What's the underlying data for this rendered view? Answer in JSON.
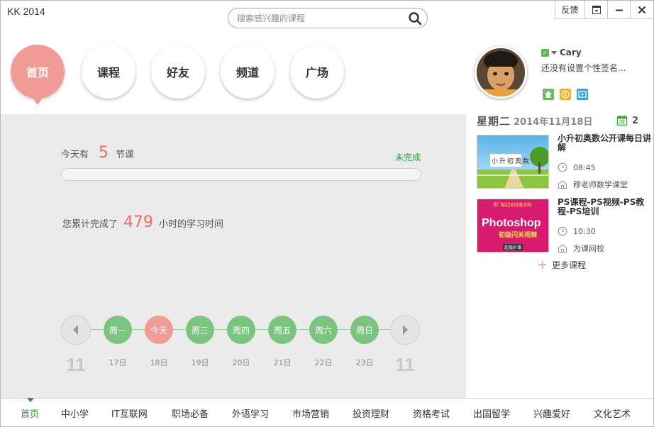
{
  "app": {
    "title": "KK 2014"
  },
  "search": {
    "placeholder": "搜索感兴趣的课程"
  },
  "window_controls": {
    "feedback": "反馈"
  },
  "nav": [
    {
      "label": "首页",
      "active": true
    },
    {
      "label": "课程"
    },
    {
      "label": "好友"
    },
    {
      "label": "频道"
    },
    {
      "label": "广场"
    }
  ],
  "today": {
    "prefix": "今天有",
    "count": "5",
    "suffix": "节课",
    "status": "未完成",
    "progress": 0
  },
  "total": {
    "prefix": "您累计完成了",
    "hours": "479",
    "suffix": "小时的学习时间"
  },
  "week": {
    "month_left": "11",
    "month_right": "11",
    "days": [
      {
        "label": "周一",
        "date": "17日"
      },
      {
        "label": "今天",
        "date": "18日",
        "today": true
      },
      {
        "label": "周三",
        "date": "19日"
      },
      {
        "label": "周四",
        "date": "20日"
      },
      {
        "label": "周五",
        "date": "21日"
      },
      {
        "label": "周六",
        "date": "22日"
      },
      {
        "label": "周日",
        "date": "23日"
      }
    ]
  },
  "user": {
    "name": "Cary",
    "signature": "还没有设置个性签名..."
  },
  "schedule": {
    "weekday": "星期二",
    "date": "2014年11月18日",
    "calendar_count": "2",
    "courses": [
      {
        "title": "小升初奥数公开课每日讲解",
        "time": "08:45",
        "school": "穆老师数学课堂",
        "thumb_text": "小升初奥数"
      },
      {
        "title": "PS课程-PS视频-PS教程-PS培训",
        "time": "10:30",
        "school": "为课网校",
        "thumb_line1": "零门槛超值限量抢购",
        "thumb_line2": "Photoshop",
        "thumb_line3": "初级闪关视频",
        "thumb_line4": "超值好课"
      }
    ],
    "more": "更多课程"
  },
  "categories": [
    {
      "label": "首页",
      "active": true
    },
    {
      "label": "中小学"
    },
    {
      "label": "IT互联网"
    },
    {
      "label": "职场必备"
    },
    {
      "label": "外语学习"
    },
    {
      "label": "市场营销"
    },
    {
      "label": "投资理财"
    },
    {
      "label": "资格考试"
    },
    {
      "label": "出国留学"
    },
    {
      "label": "兴趣爱好"
    },
    {
      "label": "文化艺术"
    }
  ],
  "colors": {
    "accent_pink": "#f19a96",
    "green": "#7bc47f",
    "number_red": "#ee6a6a",
    "status_green": "#2a9a3a"
  }
}
